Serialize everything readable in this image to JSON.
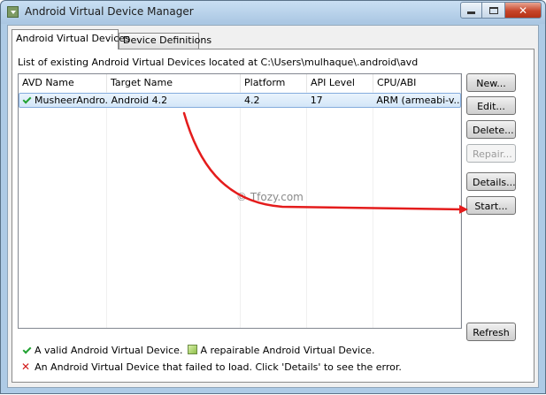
{
  "window": {
    "title": "Android Virtual Device Manager",
    "controls": {
      "minimize": "minimize",
      "maximize": "maximize",
      "close": "✕"
    }
  },
  "tabs": [
    {
      "label": "Android Virtual Devices",
      "active": true
    },
    {
      "label": "Device Definitions",
      "active": false
    }
  ],
  "listing": "List of existing Android Virtual Devices located at C:\\Users\\mulhaque\\.android\\avd",
  "table": {
    "columns": [
      "AVD Name",
      "Target Name",
      "Platform",
      "API Level",
      "CPU/ABI"
    ],
    "rows": [
      {
        "avd_name": "MusheerAndro...",
        "target": "Android 4.2",
        "platform": "4.2",
        "api_level": "17",
        "cpu_abi": "ARM (armeabi-v...",
        "status": "valid"
      }
    ]
  },
  "buttons": {
    "new": "New...",
    "edit": "Edit...",
    "delete": "Delete...",
    "repair": "Repair...",
    "details": "Details...",
    "start": "Start...",
    "refresh": "Refresh"
  },
  "legend": {
    "valid": "A valid Android Virtual Device.",
    "repairable": "A repairable Android Virtual Device.",
    "failed": "An Android Virtual Device that failed to load. Click 'Details' to see the error."
  },
  "watermark": "© Tfozy.com",
  "colors": {
    "accent_arrow": "#e41c1c",
    "valid_check": "#22a232",
    "failed_cross": "#d21a1a",
    "selection": "#d3e6f8"
  }
}
